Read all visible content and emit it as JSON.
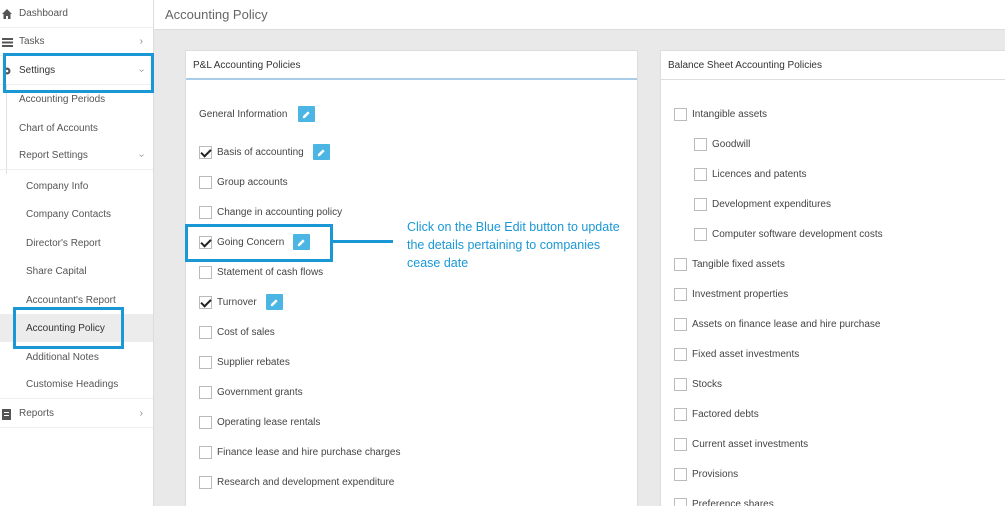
{
  "sidebar": {
    "dashboard": "Dashboard",
    "tasks": "Tasks",
    "settings": "Settings",
    "accounting_periods": "Accounting Periods",
    "chart_of_accounts": "Chart of Accounts",
    "report_settings": "Report Settings",
    "company_info": "Company Info",
    "company_contacts": "Company Contacts",
    "directors_report": "Director's Report",
    "share_capital": "Share Capital",
    "accountants_report": "Accountant's Report",
    "accounting_policy": "Accounting Policy",
    "additional_notes": "Additional Notes",
    "customise_headings": "Customise Headings",
    "reports": "Reports"
  },
  "header": {
    "title": "Accounting Policy"
  },
  "pl_panel": {
    "title": "P&L Accounting Policies",
    "general_information": "General Information",
    "items": [
      {
        "label": "Basis of accounting",
        "checked": true
      },
      {
        "label": "Group accounts",
        "checked": false
      },
      {
        "label": "Change in accounting policy",
        "checked": false
      },
      {
        "label": "Going Concern",
        "checked": true
      },
      {
        "label": "Statement of cash flows",
        "checked": false
      },
      {
        "label": "Turnover",
        "checked": true
      },
      {
        "label": "Cost of sales",
        "checked": false
      },
      {
        "label": "Supplier rebates",
        "checked": false
      },
      {
        "label": "Government grants",
        "checked": false
      },
      {
        "label": "Operating lease rentals",
        "checked": false
      },
      {
        "label": "Finance lease and hire purchase charges",
        "checked": false
      },
      {
        "label": "Research and development expenditure",
        "checked": false
      }
    ]
  },
  "bs_panel": {
    "title": "Balance Sheet Accounting Policies",
    "items": [
      {
        "label": "Intangible assets"
      },
      {
        "label": "Goodwill"
      },
      {
        "label": "Licences and patents"
      },
      {
        "label": "Development expenditures"
      },
      {
        "label": "Computer software development costs"
      },
      {
        "label": "Tangible fixed assets"
      },
      {
        "label": "Investment properties"
      },
      {
        "label": "Assets on finance lease and hire purchase"
      },
      {
        "label": "Fixed asset investments"
      },
      {
        "label": "Stocks"
      },
      {
        "label": "Factored debts"
      },
      {
        "label": "Current asset investments"
      },
      {
        "label": "Provisions"
      },
      {
        "label": "Preference shares"
      }
    ]
  },
  "annotation": {
    "text": "Click on the Blue Edit button to update the details pertaining to companies cease date"
  },
  "colors": {
    "accent": "#1a98d5",
    "edit_button": "#4bb6e3"
  },
  "icons": [
    "home-icon",
    "tasks-icon",
    "settings-icon",
    "reports-icon",
    "edit-icon",
    "chevron-right-icon",
    "chevron-down-icon"
  ]
}
